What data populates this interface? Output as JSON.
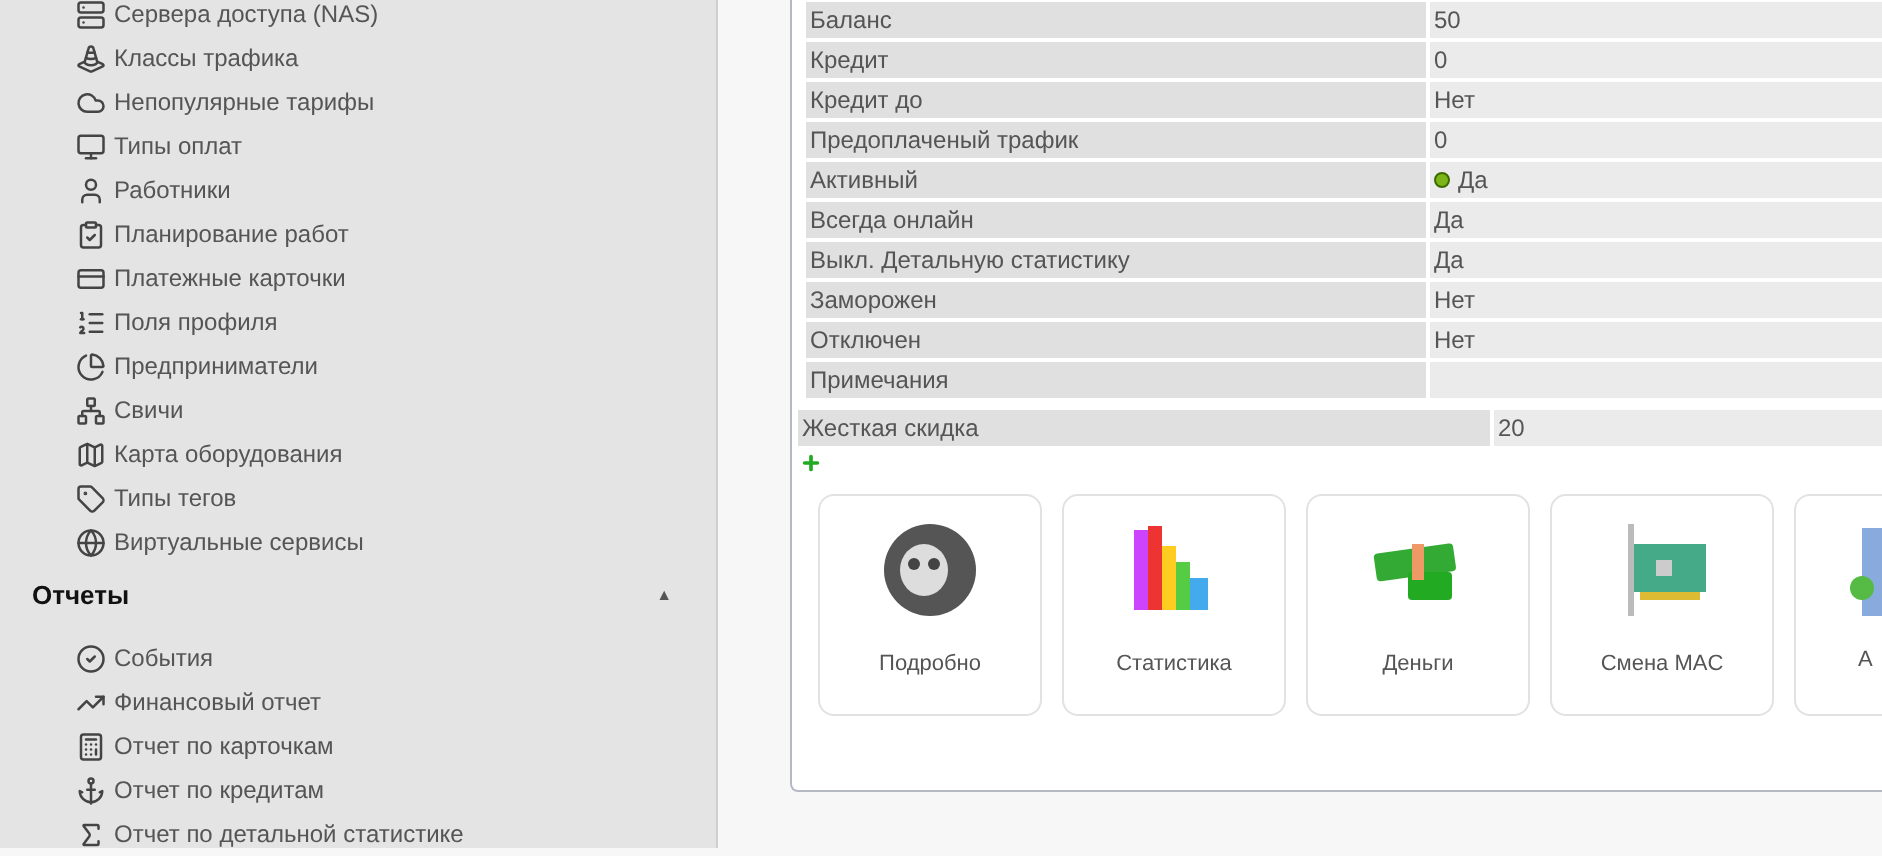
{
  "sidebar": {
    "items": [
      {
        "label": "Сервера доступа (NAS)"
      },
      {
        "label": "Классы трафика"
      },
      {
        "label": "Непопулярные тарифы"
      },
      {
        "label": "Типы оплат"
      },
      {
        "label": "Работники"
      },
      {
        "label": "Планирование работ"
      },
      {
        "label": "Платежные карточки"
      },
      {
        "label": "Поля профиля"
      },
      {
        "label": "Предприниматели"
      },
      {
        "label": "Свичи"
      },
      {
        "label": "Карта оборудования"
      },
      {
        "label": "Типы тегов"
      },
      {
        "label": "Виртуальные сервисы"
      }
    ],
    "sections": [
      {
        "title": "Отчеты",
        "expanded": true,
        "toggle": "▲",
        "items": [
          {
            "label": "События"
          },
          {
            "label": "Финансовый отчет"
          },
          {
            "label": "Отчет по карточкам"
          },
          {
            "label": "Отчет по кредитам"
          },
          {
            "label": "Отчет по детальной статистике"
          }
        ]
      }
    ]
  },
  "info_table": {
    "rows": [
      {
        "label": "Баланс",
        "value": "50",
        "kind": "plain"
      },
      {
        "label": "Кредит",
        "value": "0",
        "kind": "plain"
      },
      {
        "label": "Кредит до",
        "value": "Нет",
        "kind": "plain"
      },
      {
        "label": "Предоплаченый трафик",
        "value": "0",
        "kind": "plain"
      },
      {
        "label": "Активный",
        "value": "Да",
        "kind": "status"
      },
      {
        "label": "Всегда онлайн",
        "value": "Да",
        "kind": "plain"
      },
      {
        "label": "Выкл. Детальную статистику",
        "value": "Да",
        "kind": "plain"
      },
      {
        "label": "Заморожен",
        "value": "Нет",
        "kind": "plain"
      },
      {
        "label": "Отключен",
        "value": "Нет",
        "kind": "plain"
      },
      {
        "label": "Примечания",
        "value": "",
        "kind": "plain"
      }
    ]
  },
  "discount_table": {
    "rows": [
      {
        "label": "Жесткая скидка",
        "value": "20"
      }
    ]
  },
  "actions": [
    {
      "label": "Подробно"
    },
    {
      "label": "Статистика"
    },
    {
      "label": "Деньги"
    },
    {
      "label": "Смена MAC"
    },
    {
      "label": "А",
      "kind": "partial"
    }
  ]
}
